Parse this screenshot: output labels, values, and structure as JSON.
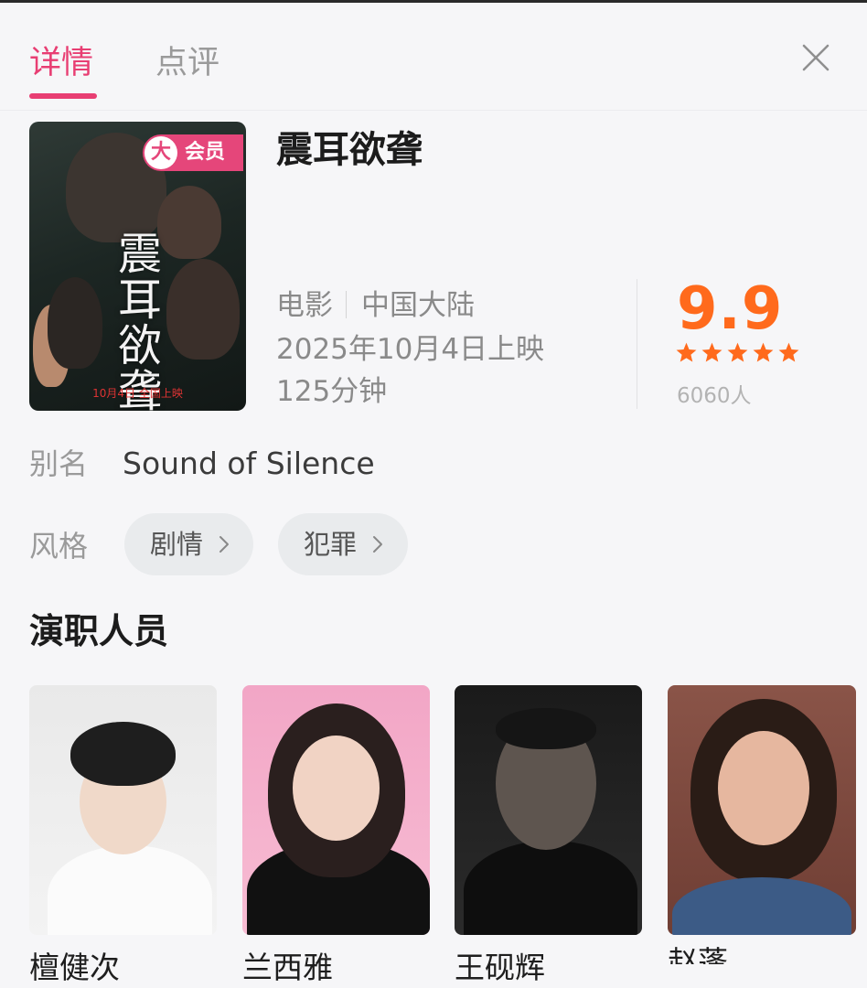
{
  "tabs": {
    "active": "详情",
    "inactive": "点评"
  },
  "icons": {
    "close": "close-icon",
    "star": "star-icon",
    "chevron": "chevron-right-icon"
  },
  "colors": {
    "accent": "#e83e73",
    "rating": "#ff6a1c",
    "vip": "#e5467a"
  },
  "movie": {
    "title": "震耳欲聋",
    "poster": {
      "vip_badge_circle": "大",
      "vip_badge_text": "会员",
      "calligraphy": "震\n耳\n欲\n聋",
      "release_strip": "10月4日 全国上映"
    },
    "type": "电影",
    "region": "中国大陆",
    "release": "2025年10月4日上映",
    "duration": "125分钟",
    "rating": "9.9",
    "stars": 5,
    "rating_count": "6060人"
  },
  "alias": {
    "label": "别名",
    "value": "Sound of Silence"
  },
  "genre": {
    "label": "风格",
    "items": [
      "剧情",
      "犯罪"
    ]
  },
  "cast_section": {
    "title": "演职人员",
    "members": [
      {
        "name": "檀健次"
      },
      {
        "name": "兰西雅"
      },
      {
        "name": "王砚辉"
      },
      {
        "name": "赵蓬"
      }
    ]
  }
}
